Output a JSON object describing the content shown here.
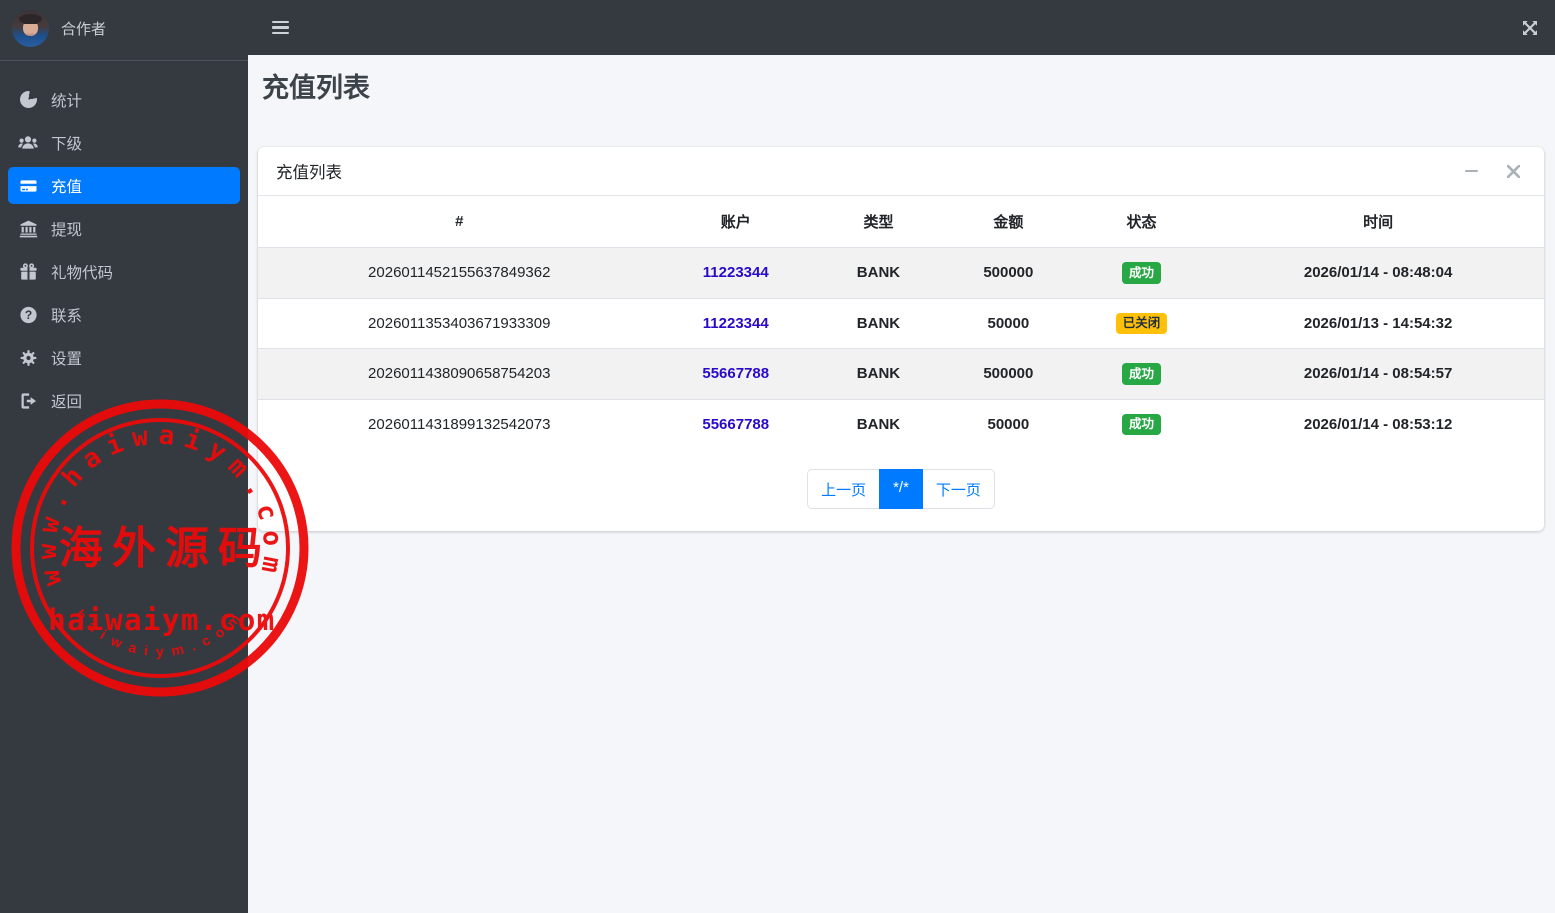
{
  "colors": {
    "accent": "#007bff",
    "success": "#28a745",
    "warning": "#ffc107",
    "sidebar_bg": "#343a40",
    "topbar_bg": "#343a40",
    "page_bg": "#f4f6f9",
    "account_link": "#2a0ac8",
    "stamp_red": "#ec0a0a"
  },
  "sidebar": {
    "user": "合作者",
    "items": [
      {
        "label": "统计",
        "icon": "chart-pie-icon",
        "active": false
      },
      {
        "label": "下级",
        "icon": "users-icon",
        "active": false
      },
      {
        "label": "充值",
        "icon": "credit-card-icon",
        "active": true
      },
      {
        "label": "提现",
        "icon": "bank-icon",
        "active": false
      },
      {
        "label": "礼物代码",
        "icon": "gift-icon",
        "active": false
      },
      {
        "label": "联系",
        "icon": "question-circle-icon",
        "active": false
      },
      {
        "label": "设置",
        "icon": "gear-icon",
        "active": false
      },
      {
        "label": "返回",
        "icon": "logout-icon",
        "active": false
      }
    ]
  },
  "topbar": {
    "menu_icon": "bars-icon",
    "fullscreen_icon": "expand-arrows-icon"
  },
  "page": {
    "title": "充值列表"
  },
  "card": {
    "title": "充值列表",
    "tools": [
      "minus-icon",
      "close-icon"
    ]
  },
  "table": {
    "headers": [
      "#",
      "账户",
      "类型",
      "金额",
      "状态",
      "时间"
    ],
    "rows": [
      {
        "id": "2026011452155637849362",
        "account": "11223344",
        "type": "BANK",
        "amount": "500000",
        "status": "成功",
        "status_kind": "success",
        "time": "2026/01/14 - 08:48:04"
      },
      {
        "id": "2026011353403671933309",
        "account": "11223344",
        "type": "BANK",
        "amount": "50000",
        "status": "已关闭",
        "status_kind": "warning",
        "time": "2026/01/13 - 14:54:32"
      },
      {
        "id": "2026011438090658754203",
        "account": "55667788",
        "type": "BANK",
        "amount": "500000",
        "status": "成功",
        "status_kind": "success",
        "time": "2026/01/14 - 08:54:57"
      },
      {
        "id": "2026011431899132542073",
        "account": "55667788",
        "type": "BANK",
        "amount": "50000",
        "status": "成功",
        "status_kind": "success",
        "time": "2026/01/14 - 08:53:12"
      }
    ]
  },
  "pagination": {
    "prev": "上一页",
    "current": "*/*",
    "next": "下一页"
  },
  "watermark": {
    "arc_top": "www.haiwaiym.com",
    "center_cn": "海外源码",
    "center_en": "haiwaiym.com",
    "arc_bottom": "haiwaiym.com"
  }
}
